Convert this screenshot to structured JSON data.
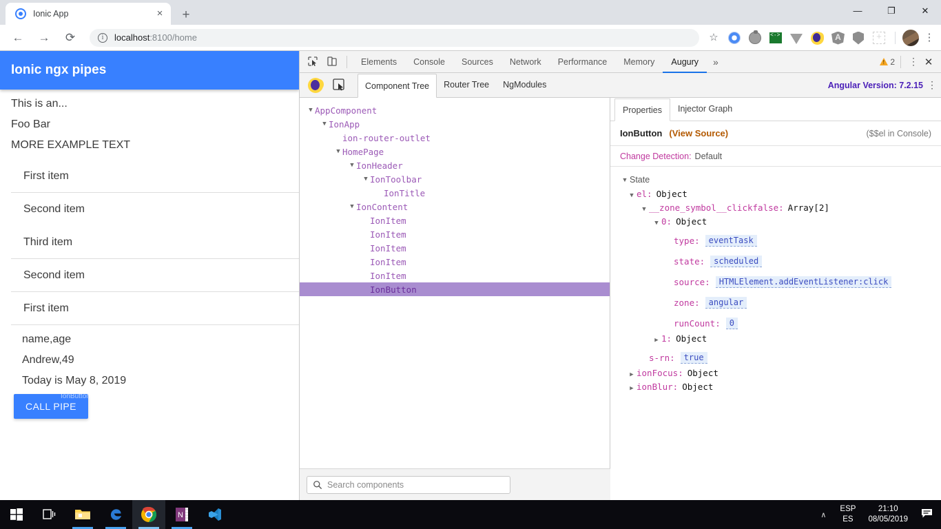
{
  "browser": {
    "tab": {
      "title": "Ionic App",
      "favicon": "ionic-favicon",
      "close": "×"
    },
    "new_tab": "+",
    "window_controls": {
      "minimize": "—",
      "maximize": "❐",
      "close": "✕"
    },
    "nav": {
      "back": "←",
      "forward": "→",
      "reload": "⟳"
    },
    "omnibox": {
      "info_icon": "i",
      "url_host": "localhost",
      "url_path": ":8100/home"
    },
    "star": "☆",
    "extensions": [
      "ionic-extension-icon",
      "tomato-timer-icon",
      "green-terminal-icon",
      "vue-devtools-icon",
      "augury-moon-icon",
      "angular-icon",
      "shield-icon",
      "grid-icon"
    ],
    "avatar": "profile-avatar",
    "menu": "⋮"
  },
  "app": {
    "header_title": "Ionic ngx pipes",
    "paragraphs": [
      "This is an...",
      "Foo Bar",
      "MORE EXAMPLE TEXT"
    ],
    "list_items": [
      "First item",
      "Second item",
      "Third item",
      "Second item",
      "First item"
    ],
    "after_list": [
      "name,age",
      "Andrew,49",
      "Today is May 8, 2019"
    ],
    "button_label": "CALL PIPE",
    "button_overlay_label": "IonButton",
    "colors": {
      "primary": "#3880ff",
      "button": "#3880ff"
    }
  },
  "devtools": {
    "icons": {
      "inspect": "inspect-element-icon",
      "device": "device-toolbar-icon"
    },
    "tabs": [
      {
        "label": "Elements",
        "active": false
      },
      {
        "label": "Console",
        "active": false
      },
      {
        "label": "Sources",
        "active": false
      },
      {
        "label": "Network",
        "active": false
      },
      {
        "label": "Performance",
        "active": false
      },
      {
        "label": "Memory",
        "active": false
      },
      {
        "label": "Augury",
        "active": true
      }
    ],
    "more_tabs": "»",
    "warning_count": "2",
    "kebab": "⋮",
    "close": "✕"
  },
  "augury": {
    "logo": "augury-moon-logo",
    "picker": "element-picker-icon",
    "tabs": [
      {
        "label": "Component Tree",
        "active": true
      },
      {
        "label": "Router Tree",
        "active": false
      },
      {
        "label": "NgModules",
        "active": false
      }
    ],
    "angular_version_label": "Angular Version: 7.2.15",
    "kebab": "⋮",
    "tree": [
      {
        "label": "AppComponent",
        "depth": 0,
        "caret": "▼",
        "selected": false
      },
      {
        "label": "IonApp",
        "depth": 1,
        "caret": "▼",
        "selected": false
      },
      {
        "label": "ion-router-outlet",
        "depth": 2,
        "caret": "",
        "selected": false
      },
      {
        "label": "HomePage",
        "depth": 2,
        "caret": "▼",
        "selected": false
      },
      {
        "label": "IonHeader",
        "depth": 3,
        "caret": "▼",
        "selected": false
      },
      {
        "label": "IonToolbar",
        "depth": 4,
        "caret": "▼",
        "selected": false
      },
      {
        "label": "IonTitle",
        "depth": 5,
        "caret": "",
        "selected": false
      },
      {
        "label": "IonContent",
        "depth": 3,
        "caret": "▼",
        "selected": false
      },
      {
        "label": "IonItem",
        "depth": 4,
        "caret": "",
        "selected": false
      },
      {
        "label": "IonItem",
        "depth": 4,
        "caret": "",
        "selected": false
      },
      {
        "label": "IonItem",
        "depth": 4,
        "caret": "",
        "selected": false
      },
      {
        "label": "IonItem",
        "depth": 4,
        "caret": "",
        "selected": false
      },
      {
        "label": "IonItem",
        "depth": 4,
        "caret": "",
        "selected": false
      },
      {
        "label": "IonButton",
        "depth": 4,
        "caret": "",
        "selected": true
      }
    ],
    "search": {
      "icon": "search-icon",
      "placeholder": "Search components"
    },
    "selected_row_color": "#a98dd0"
  },
  "properties": {
    "tabs": [
      {
        "label": "Properties",
        "active": true
      },
      {
        "label": "Injector Graph",
        "active": false
      }
    ],
    "component_name": "IonButton",
    "view_source": "(View Source)",
    "console_hint": "($$el in Console)",
    "change_detection_key": "Change Detection:",
    "change_detection_value": "Default",
    "state_label": "State",
    "state_caret": "▼",
    "rows": [
      {
        "caret": "▼",
        "indent": 1,
        "key": "el:",
        "type": "Object",
        "value": "",
        "keyStyle": "pink"
      },
      {
        "caret": "▼",
        "indent": 2,
        "key": "__zone_symbol__clickfalse:",
        "type": "Array[2]",
        "value": "",
        "keyStyle": "pink"
      },
      {
        "caret": "▼",
        "indent": 3,
        "key": "0:",
        "type": "Object",
        "value": "",
        "keyStyle": "pink"
      },
      {
        "caret": "",
        "indent": 4,
        "key": "type:",
        "type": "",
        "value": "eventTask",
        "keyStyle": "pink"
      },
      {
        "caret": "",
        "indent": 4,
        "key": "state:",
        "type": "",
        "value": "scheduled",
        "keyStyle": "pink"
      },
      {
        "caret": "",
        "indent": 4,
        "key": "source:",
        "type": "",
        "value": "HTMLElement.addEventListener:click",
        "keyStyle": "pink"
      },
      {
        "caret": "",
        "indent": 4,
        "key": "zone:",
        "type": "",
        "value": "angular",
        "keyStyle": "pink"
      },
      {
        "caret": "",
        "indent": 4,
        "key": "runCount:",
        "type": "",
        "value": "0",
        "keyStyle": "pink"
      },
      {
        "caret": "▶",
        "indent": 3,
        "key": "1:",
        "type": "Object",
        "value": "",
        "keyStyle": "pink"
      },
      {
        "caret": "",
        "indent": 2,
        "key": "s-rn:",
        "type": "",
        "value": "true",
        "keyStyle": "pink"
      },
      {
        "caret": "▶",
        "indent": 1,
        "key": "ionFocus:",
        "type": "Object",
        "value": "",
        "keyStyle": "pink"
      },
      {
        "caret": "▶",
        "indent": 1,
        "key": "ionBlur:",
        "type": "Object",
        "value": "",
        "keyStyle": "pink"
      }
    ]
  },
  "taskbar": {
    "items": [
      {
        "name": "start-button",
        "icon": "windows-logo",
        "active": false
      },
      {
        "name": "task-view-button",
        "icon": "task-view",
        "active": false
      },
      {
        "name": "file-explorer",
        "icon": "folder",
        "active": false
      },
      {
        "name": "edge-browser",
        "icon": "edge",
        "active": false
      },
      {
        "name": "chrome-browser",
        "icon": "chrome",
        "active": true
      },
      {
        "name": "onenote",
        "icon": "onenote",
        "active": false
      },
      {
        "name": "vs-code",
        "icon": "vscode",
        "active": false
      }
    ],
    "tray": {
      "chevron": "∧",
      "lang_top": "ESP",
      "lang_bottom": "ES",
      "time": "21:10",
      "date": "08/05/2019",
      "action_center": "action-center-icon"
    }
  }
}
